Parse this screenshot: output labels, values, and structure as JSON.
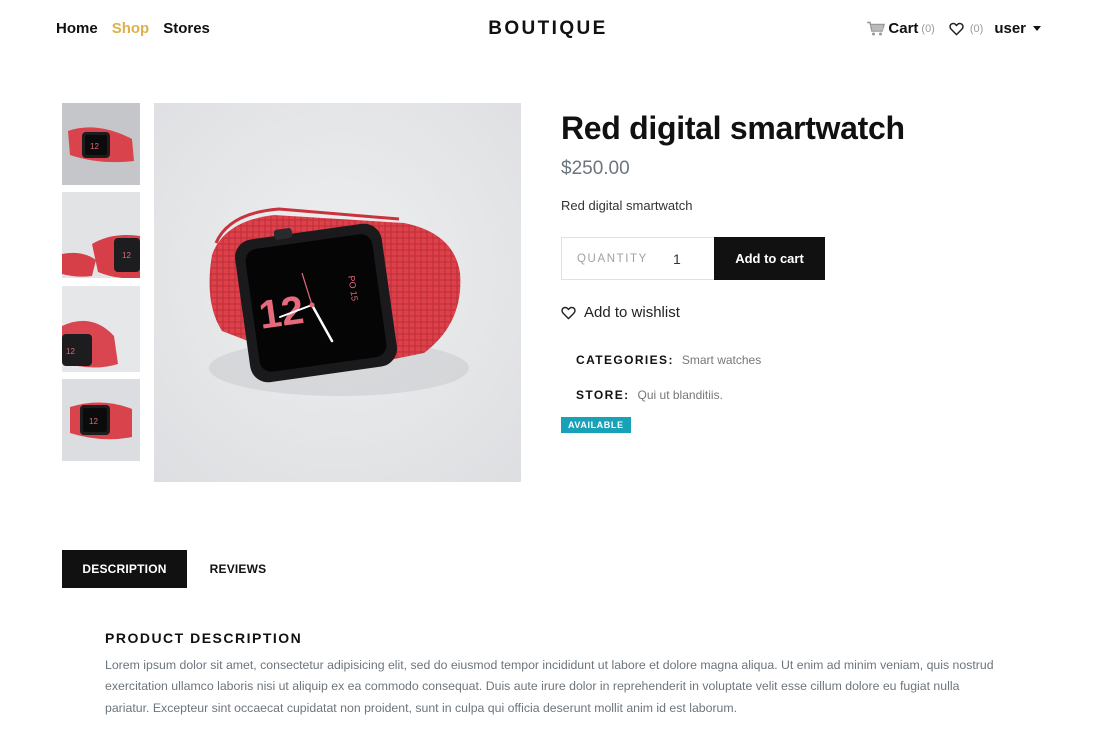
{
  "header": {
    "nav": [
      {
        "label": "Home",
        "active": false
      },
      {
        "label": "Shop",
        "active": true
      },
      {
        "label": "Stores",
        "active": false
      }
    ],
    "brand": "BOUTIQUE",
    "cart": {
      "label": "Cart",
      "count": "(0)",
      "icon": "cart-icon"
    },
    "wishlist": {
      "count": "(0)",
      "icon": "heart-icon"
    },
    "user": {
      "label": "user",
      "icon": "chevron-down-icon"
    }
  },
  "product": {
    "title": "Red digital smartwatch",
    "price": "$250.00",
    "short_description": "Red digital smartwatch",
    "quantity_label": "QUANTITY",
    "quantity_value": "1",
    "add_to_cart_label": "Add to cart",
    "wishlist_label": "Add to wishlist",
    "categories_label": "CATEGORIES:",
    "categories_value": "Smart watches",
    "store_label": "STORE:",
    "store_value": "Qui ut blanditiis.",
    "availability": "AVAILABLE",
    "watch_face_hour": "12",
    "watch_face_date": "PO 15"
  },
  "gallery": {
    "thumbnail_count": 4,
    "main_image": "red-smartwatch-photo"
  },
  "tabs": [
    {
      "label": "DESCRIPTION",
      "active": true
    },
    {
      "label": "REVIEWS",
      "active": false
    }
  ],
  "description": {
    "heading": "PRODUCT DESCRIPTION",
    "body": "Lorem ipsum dolor sit amet, consectetur adipisicing elit, sed do eiusmod tempor incididunt ut labore et dolore magna aliqua. Ut enim ad minim veniam, quis nostrud exercitation ullamco laboris nisi ut aliquip ex ea commodo consequat. Duis aute irure dolor in reprehenderit in voluptate velit esse cillum dolore eu fugiat nulla pariatur. Excepteur sint occaecat cupidatat non proident, sunt in culpa qui officia deserunt mollit anim id est laborum."
  },
  "colors": {
    "accent": "#dcb14a",
    "badge": "#17a2b8",
    "button": "#111111",
    "muted": "#6c757d"
  }
}
